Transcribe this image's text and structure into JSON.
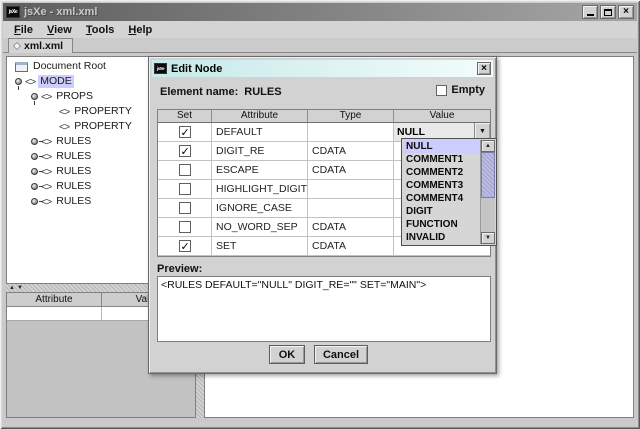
{
  "window": {
    "title": "jsXe - xml.xml"
  },
  "colors": {
    "selection": "#ccccff",
    "dialog_titlebar": "#c6e9e9",
    "titlebar": "#6f6f6f"
  },
  "icons": {
    "app_logo": "jsXe",
    "minimize": "_",
    "maximize": "□",
    "close": "×",
    "tab_diamond": "◇",
    "element_glyph": "<>",
    "check": "✓",
    "combo_arrow": "▼",
    "scroll_up": "▲",
    "scroll_down": "▼",
    "split_up": "▲",
    "split_down": "▼",
    "split_left": "◀",
    "split_right": "▶"
  },
  "menu": {
    "items": [
      {
        "label": "File"
      },
      {
        "label": "View"
      },
      {
        "label": "Tools"
      },
      {
        "label": "Help"
      }
    ]
  },
  "tabs": {
    "active": {
      "label": "xml.xml"
    }
  },
  "tree": {
    "nodes": [
      {
        "label": "Document Root",
        "icon": "document-root",
        "indent": 8,
        "handle": null,
        "selected": false
      },
      {
        "label": "MODE",
        "icon": "element",
        "indent": 8,
        "handle": "expanded",
        "selected": true
      },
      {
        "label": "PROPS",
        "icon": "element",
        "indent": 24,
        "handle": "expanded",
        "selected": false
      },
      {
        "label": "PROPERTY",
        "icon": "element",
        "indent": 52,
        "handle": null,
        "selected": false
      },
      {
        "label": "PROPERTY",
        "icon": "element",
        "indent": 52,
        "handle": null,
        "selected": false
      },
      {
        "label": "RULES",
        "icon": "element",
        "indent": 24,
        "handle": "collapsed",
        "selected": false
      },
      {
        "label": "RULES",
        "icon": "element",
        "indent": 24,
        "handle": "collapsed",
        "selected": false
      },
      {
        "label": "RULES",
        "icon": "element",
        "indent": 24,
        "handle": "collapsed",
        "selected": false
      },
      {
        "label": "RULES",
        "icon": "element",
        "indent": 24,
        "handle": "collapsed",
        "selected": false
      },
      {
        "label": "RULES",
        "icon": "element",
        "indent": 24,
        "handle": "collapsed",
        "selected": false
      }
    ]
  },
  "attr_panel": {
    "columns": [
      "Attribute",
      "Value"
    ]
  },
  "dialog": {
    "title": "Edit Node",
    "element_name_label": "Element name:",
    "element_name": "RULES",
    "empty_label": "Empty",
    "empty_checked": false,
    "table": {
      "columns": [
        "Set",
        "Attribute",
        "Type",
        "Value"
      ],
      "rows": [
        {
          "set": true,
          "attribute": "DEFAULT",
          "type": "",
          "value": "NULL",
          "combo": true
        },
        {
          "set": true,
          "attribute": "DIGIT_RE",
          "type": "CDATA",
          "value": ""
        },
        {
          "set": false,
          "attribute": "ESCAPE",
          "type": "CDATA",
          "value": ""
        },
        {
          "set": false,
          "attribute": "HIGHLIGHT_DIGITS",
          "type": "",
          "value": ""
        },
        {
          "set": false,
          "attribute": "IGNORE_CASE",
          "type": "",
          "value": ""
        },
        {
          "set": false,
          "attribute": "NO_WORD_SEP",
          "type": "CDATA",
          "value": ""
        },
        {
          "set": true,
          "attribute": "SET",
          "type": "CDATA",
          "value": ""
        }
      ]
    },
    "dropdown": {
      "items": [
        "NULL",
        "COMMENT1",
        "COMMENT2",
        "COMMENT3",
        "COMMENT4",
        "DIGIT",
        "FUNCTION",
        "INVALID"
      ],
      "selected_index": 0
    },
    "preview_label": "Preview:",
    "preview_text": "<RULES DEFAULT=\"NULL\" DIGIT_RE=\"\" SET=\"MAIN\">",
    "buttons": {
      "ok": "OK",
      "cancel": "Cancel"
    }
  }
}
